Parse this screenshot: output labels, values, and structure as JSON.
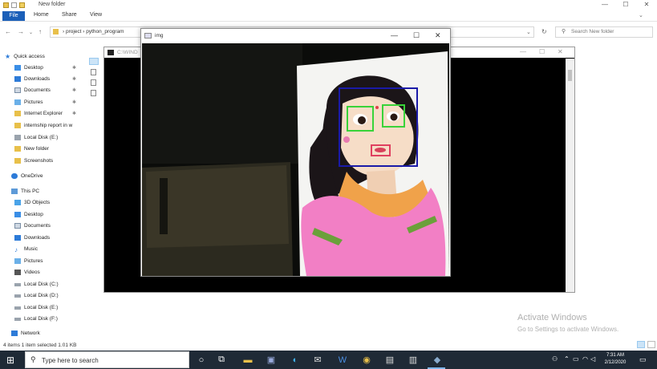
{
  "explorer": {
    "title": "New folder",
    "ribbon_tabs": [
      "File",
      "Home",
      "Share",
      "View"
    ],
    "address_path": "›  project  ›  python_program",
    "search_placeholder": "Search New folder",
    "status_text": "4 items    1 item selected  1.01 KB"
  },
  "nav": {
    "quick_access": "Quick access",
    "items": [
      {
        "label": "Desktop",
        "pinned": true
      },
      {
        "label": "Downloads",
        "pinned": true
      },
      {
        "label": "Documents",
        "pinned": true
      },
      {
        "label": "Pictures",
        "pinned": true
      },
      {
        "label": "Internet Explorer",
        "pinned": true
      },
      {
        "label": "internship report in w",
        "pinned": false
      },
      {
        "label": "Local Disk (E:)",
        "pinned": false
      },
      {
        "label": "New folder",
        "pinned": false
      },
      {
        "label": "Screenshots",
        "pinned": false
      }
    ],
    "onedrive": "OneDrive",
    "this_pc": "This PC",
    "pc_items": [
      "3D Objects",
      "Desktop",
      "Documents",
      "Downloads",
      "Music",
      "Pictures",
      "Videos",
      "Local Disk (C:)",
      "Local Disk (D:)",
      "Local Disk (E:)",
      "Local Disk (F:)"
    ],
    "network": "Network"
  },
  "cmd_window": {
    "title": "C:\\WIND"
  },
  "img_window": {
    "title": "img"
  },
  "watermark": {
    "line1": "Activate Windows",
    "line2": "Go to Settings to activate Windows."
  },
  "taskbar": {
    "search_placeholder": "Type here to search",
    "time": "7:31 AM",
    "date": "2/12/2020"
  },
  "colors": {
    "face_box": "#1a1aa8",
    "eye_box": "#39d339",
    "mouth_box": "#e04060",
    "accent": "#1b5fb8"
  }
}
